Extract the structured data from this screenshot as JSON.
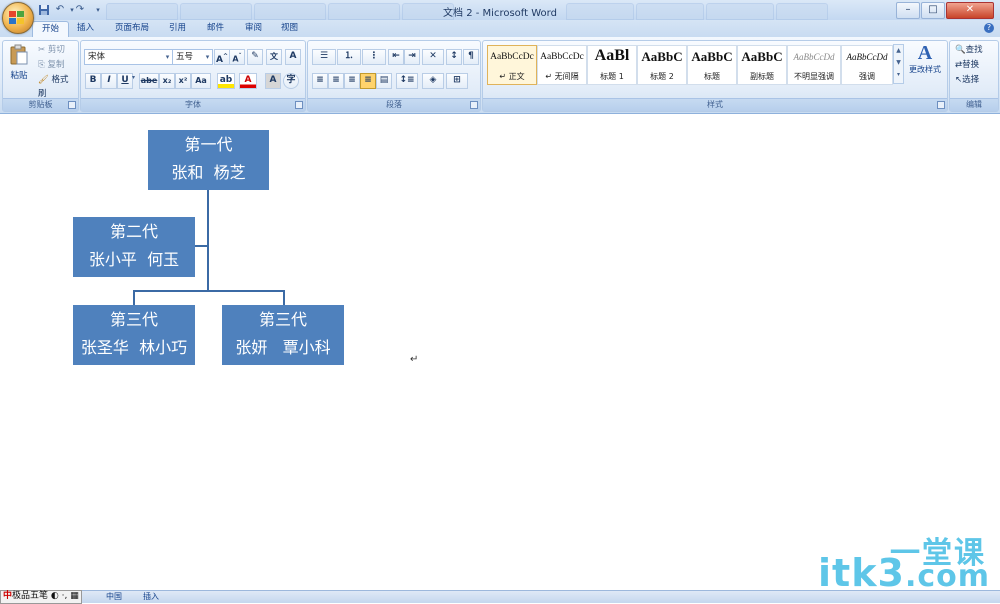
{
  "window": {
    "title": "文档 2 - Microsoft Word",
    "controls": [
      "minimize-icon",
      "maximize-icon",
      "close-icon"
    ]
  },
  "qat": [
    "save-icon",
    "undo-icon",
    "redo-icon"
  ],
  "tabs": [
    {
      "label": "开始",
      "active": true
    },
    {
      "label": "插入"
    },
    {
      "label": "页面布局"
    },
    {
      "label": "引用"
    },
    {
      "label": "邮件"
    },
    {
      "label": "审阅"
    },
    {
      "label": "视图"
    }
  ],
  "ribbon": {
    "clipboard": {
      "paste": "粘贴",
      "cut": "剪切",
      "copy": "复制",
      "format_painter": "格式刷",
      "label": "剪贴板"
    },
    "font": {
      "name": "宋体",
      "size": "五号",
      "label": "字体",
      "buttons": [
        "B",
        "I",
        "U",
        "abe",
        "x₂",
        "x²",
        "Aa",
        "A",
        "A"
      ]
    },
    "paragraph": {
      "label": "段落"
    },
    "styles": {
      "label": "样式",
      "items": [
        {
          "sample": "AaBbCcDc",
          "name": "↵ 正文"
        },
        {
          "sample": "AaBbCcDc",
          "name": "↵ 无间隔"
        },
        {
          "sample": "AaBl",
          "name": "标题 1"
        },
        {
          "sample": "AaBbC",
          "name": "标题 2"
        },
        {
          "sample": "AaBbC",
          "name": "标题"
        },
        {
          "sample": "AaBbC",
          "name": "副标题"
        },
        {
          "sample": "AaBbCcDd",
          "name": "不明显强调"
        },
        {
          "sample": "AaBbCcDd",
          "name": "强调"
        }
      ],
      "change_styles": "更改样式"
    },
    "editing": {
      "find": "查找",
      "replace": "替换",
      "select": "选择",
      "label": "编辑"
    }
  },
  "document": {
    "tree": {
      "gen1": {
        "title": "第一代",
        "names": "张和  杨芝"
      },
      "gen2": {
        "title": "第二代",
        "names": "张小平  何玉"
      },
      "gen3a": {
        "title": "第三代",
        "names": "张圣华  林小巧"
      },
      "gen3b": {
        "title": "第三代",
        "names": "张妍   覃小科"
      }
    },
    "cursor_mark": "↵"
  },
  "statusbar": {
    "ime": "极品五笔",
    "ime_lang": "中国",
    "mode": "插入"
  },
  "watermark": {
    "brand": "itk3",
    "domain": ".com",
    "cn": "一堂课"
  },
  "colors": {
    "box_fill": "#4f81bd",
    "connector": "#3b6aa5",
    "ribbon_text": "#15428b"
  }
}
